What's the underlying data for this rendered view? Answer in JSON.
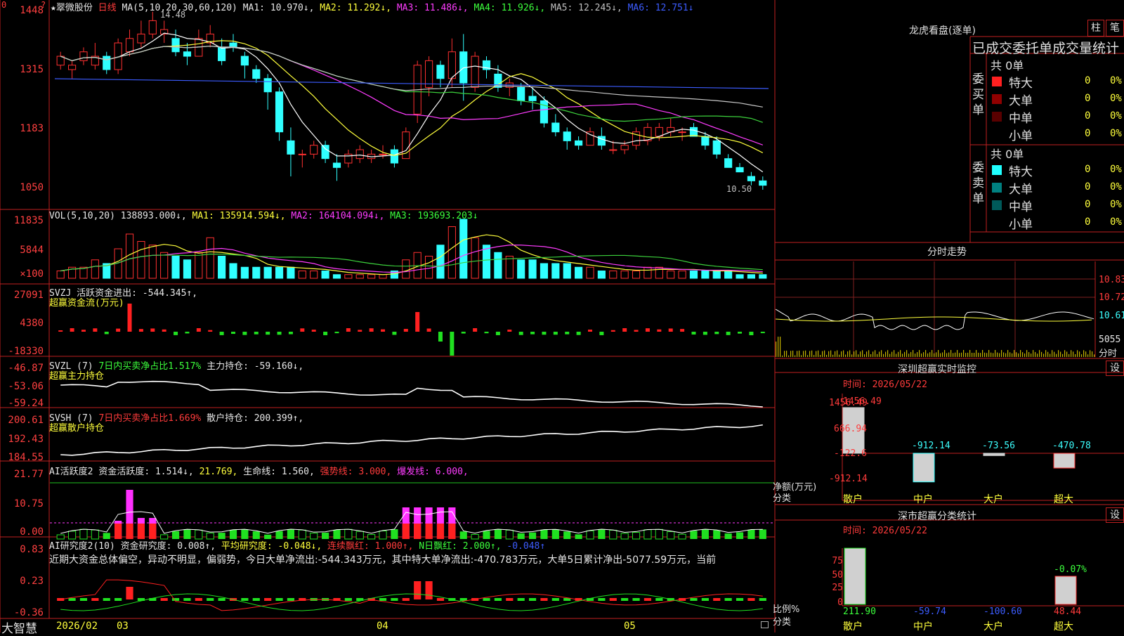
{
  "kline": {
    "title": "★翠微股份",
    "period": "日线",
    "ma_label": "MA(5,10,20,30,60,120)",
    "ma1": "MA1: 10.970↓,",
    "ma2": "MA2: 11.292↓,",
    "ma3": "MA3: 11.486↓,",
    "ma4": "MA4: 11.926↓,",
    "ma5": "MA5: 12.245↓,",
    "ma6": "MA6: 12.751↓",
    "high_mark": "14.48",
    "low_mark": "10.50",
    "y_ticks": [
      "1448",
      "1315",
      "1183",
      "1050"
    ],
    "candles": [
      [
        13.3,
        13.6,
        13.2,
        13.5
      ],
      [
        13.2,
        13.4,
        13.0,
        13.3
      ],
      [
        13.4,
        13.7,
        13.3,
        13.6
      ],
      [
        13.3,
        13.8,
        13.2,
        13.5
      ],
      [
        13.5,
        13.6,
        13.1,
        13.2
      ],
      [
        13.2,
        13.9,
        13.1,
        13.8
      ],
      [
        13.6,
        14.1,
        13.5,
        13.9
      ],
      [
        13.8,
        14.3,
        13.7,
        14.0
      ],
      [
        14.0,
        14.5,
        13.9,
        14.3
      ],
      [
        14.0,
        14.3,
        13.8,
        14.1
      ],
      [
        13.9,
        14.1,
        13.5,
        13.6
      ],
      [
        13.6,
        13.8,
        13.3,
        13.5
      ],
      [
        13.5,
        14.1,
        13.5,
        13.9
      ],
      [
        13.8,
        14.2,
        13.7,
        14.0
      ],
      [
        13.7,
        13.9,
        13.3,
        13.4
      ],
      [
        13.8,
        14.0,
        13.6,
        13.7
      ],
      [
        13.5,
        13.6,
        13.0,
        13.3
      ],
      [
        13.2,
        13.3,
        12.9,
        13.0
      ],
      [
        13.0,
        13.1,
        12.3,
        12.7
      ],
      [
        12.7,
        12.8,
        11.6,
        11.8
      ],
      [
        11.6,
        11.9,
        10.8,
        11.3
      ],
      [
        11.3,
        11.4,
        11.0,
        11.3
      ],
      [
        11.3,
        11.6,
        11.2,
        11.5
      ],
      [
        11.5,
        11.6,
        11.1,
        11.2
      ],
      [
        11.1,
        11.3,
        10.7,
        11.0
      ],
      [
        11.1,
        11.4,
        11.0,
        11.3
      ],
      [
        11.2,
        11.5,
        11.1,
        11.4
      ],
      [
        11.2,
        11.4,
        11.1,
        11.3
      ],
      [
        11.3,
        11.5,
        11.2,
        11.3
      ],
      [
        11.4,
        11.5,
        11.0,
        11.1
      ],
      [
        11.2,
        11.9,
        11.2,
        11.8
      ],
      [
        12.2,
        13.4,
        12.0,
        13.3
      ],
      [
        12.8,
        13.5,
        12.6,
        13.4
      ],
      [
        13.3,
        13.4,
        12.8,
        13.0
      ],
      [
        13.0,
        13.9,
        12.8,
        13.6
      ],
      [
        13.6,
        14.0,
        12.5,
        12.9
      ],
      [
        12.8,
        13.6,
        12.7,
        13.5
      ],
      [
        13.4,
        13.5,
        13.0,
        13.2
      ],
      [
        13.1,
        13.3,
        12.7,
        12.8
      ],
      [
        12.8,
        13.0,
        12.6,
        12.9
      ],
      [
        12.8,
        12.9,
        12.4,
        12.5
      ],
      [
        12.6,
        12.8,
        12.3,
        12.5
      ],
      [
        12.5,
        12.6,
        11.9,
        12.0
      ],
      [
        12.0,
        12.2,
        11.7,
        11.8
      ],
      [
        11.8,
        11.9,
        11.4,
        11.6
      ],
      [
        11.6,
        11.7,
        11.4,
        11.5
      ],
      [
        11.5,
        11.9,
        11.5,
        11.8
      ],
      [
        11.7,
        11.9,
        11.4,
        11.5
      ],
      [
        11.4,
        11.6,
        11.3,
        11.4
      ],
      [
        11.4,
        11.6,
        11.3,
        11.5
      ],
      [
        11.5,
        11.9,
        11.4,
        11.8
      ],
      [
        11.6,
        12.0,
        11.5,
        11.9
      ],
      [
        11.7,
        12.0,
        11.6,
        11.9
      ],
      [
        11.8,
        12.1,
        11.7,
        11.9
      ],
      [
        11.8,
        11.9,
        11.6,
        11.8
      ],
      [
        11.9,
        12.0,
        11.7,
        11.7
      ],
      [
        11.7,
        11.8,
        11.4,
        11.5
      ],
      [
        11.6,
        11.7,
        11.2,
        11.3
      ],
      [
        11.2,
        11.3,
        11.0,
        11.0
      ],
      [
        11.0,
        11.1,
        10.9,
        10.9
      ],
      [
        10.8,
        10.9,
        10.6,
        10.7
      ],
      [
        10.7,
        10.8,
        10.5,
        10.6
      ]
    ]
  },
  "vol": {
    "label": "VOL(5,10,20)",
    "val": "138893.000↓,",
    "ma1": "MA1: 135914.594↓,",
    "ma2": "MA2: 164104.094↓,",
    "ma3": "MA3: 193693.203↓",
    "y_ticks": [
      "11835",
      "5844",
      "×100"
    ],
    "bars": [
      2,
      3,
      3,
      5,
      4,
      8,
      12,
      10,
      9,
      7,
      6,
      5,
      7,
      11,
      6,
      4,
      3,
      3,
      3,
      3,
      3,
      2,
      2,
      2,
      1,
      1,
      1,
      1,
      1,
      2,
      5,
      7,
      6,
      9,
      14,
      16,
      11,
      9,
      7,
      6,
      5,
      5,
      4,
      4,
      4,
      3,
      3,
      2,
      2,
      2,
      2,
      3,
      3,
      2,
      2,
      2,
      2,
      2,
      2,
      1,
      1,
      1
    ]
  },
  "svzj": {
    "label": "SVZJ",
    "title": "活跃资金进出: -544.345↑,",
    "subtitle": "超赢资金流(万元)",
    "y_ticks": [
      "27091",
      "4380",
      "-18330"
    ]
  },
  "svzl": {
    "label": "SVZL (7)",
    "pct": "7日内买卖净占比1.517%",
    "hold": "主力持仓: -59.160↓,",
    "subtitle": "超赢主力持仓",
    "y_ticks": [
      "-46.87",
      "-53.06",
      "-59.24"
    ]
  },
  "svsh": {
    "label": "SVSH (7)",
    "pct": "7日内买卖净占比1.669%",
    "hold": "散户持仓: 200.399↑,",
    "subtitle": "超赢散户持仓",
    "y_ticks": [
      "200.61",
      "192.43",
      "184.55"
    ]
  },
  "ai_active": {
    "label": "AI活跃度2",
    "active": "资金活跃度: 1.514↓,",
    "v2": "21.769,",
    "life": "生命线: 1.560,",
    "strong": "强势线: 3.000,",
    "burst": "爆发线: 6.000,",
    "y_ticks": [
      "21.77",
      "10.75",
      "0.00"
    ]
  },
  "ai_research": {
    "label": "AI研究度2(10)",
    "research": "资金研究度: 0.008↑,",
    "avg": "平均研究度: -0.048↓,",
    "cont": "连续飘红: 1.000↑,",
    "nday": "N日飘红: 2.000↑,",
    "last": "-0.048↑",
    "summary": "近期大资金总体偏空，异动不明显，偏弱势，今日大单净流出:-544.343万元，其中特大单净流出:-470.783万元，大单5日累计净出-5077.59万元，当前",
    "y_ticks": [
      "0.83",
      "0.23",
      "-0.36"
    ]
  },
  "xaxis": {
    "logo": "大智慧",
    "labels": [
      "2026/02",
      "03",
      "04",
      "05"
    ]
  },
  "right": {
    "lhb_title": "龙虎看盘(逐单)",
    "btn_zhu": "柱",
    "btn_bi": "笔",
    "stats_title": "已成交委托单成交量统计",
    "buy": {
      "label": "委买单",
      "count": "共 0单",
      "rows": [
        {
          "name": "特大",
          "val": "0",
          "pct": "0%",
          "color": "#ff2020"
        },
        {
          "name": "大单",
          "val": "0",
          "pct": "0%",
          "color": "#900000"
        },
        {
          "name": "中单",
          "val": "0",
          "pct": "0%",
          "color": "#5a0000"
        },
        {
          "name": "小单",
          "val": "0",
          "pct": "0%",
          "color": "#000000"
        }
      ]
    },
    "sell": {
      "label": "委卖单",
      "count": "共 0单",
      "rows": [
        {
          "name": "特大",
          "val": "0",
          "pct": "0%",
          "color": "#20ffff"
        },
        {
          "name": "大单",
          "val": "0",
          "pct": "0%",
          "color": "#008080"
        },
        {
          "name": "中单",
          "val": "0",
          "pct": "0%",
          "color": "#005a5a"
        },
        {
          "name": "小单",
          "val": "0",
          "pct": "0%",
          "color": "#000000"
        }
      ]
    },
    "intraday": {
      "title": "分时走势",
      "y_ticks": [
        "10.83",
        "10.72",
        "10.61",
        "5055"
      ],
      "sub": "分时"
    },
    "monitor": {
      "title": "深圳超赢实时监控",
      "btn": "设",
      "time": "时间: 2026/05/22",
      "y_ticks": [
        "1456.49",
        "666.94",
        "-122.6",
        "-912.14"
      ],
      "ylabel1": "净额(万元)",
      "ylabel2": "分类",
      "cats": [
        "散户",
        "中户",
        "大户",
        "超大"
      ],
      "values": [
        1456.49,
        -912.14,
        -73.56,
        -470.78
      ],
      "labels": [
        "1456.49",
        "-912.14",
        "-73.56",
        "-470.78"
      ]
    },
    "classify": {
      "title": "深市超赢分类统计",
      "btn": "设",
      "time": "时间: 2026/05/22",
      "y_ticks": [
        "75",
        "50",
        "25",
        "0"
      ],
      "ylabel1": "比例%",
      "ylabel2": "分类",
      "top_label": "-0.07%",
      "cats": [
        "散户",
        "中户",
        "大户",
        "超大"
      ],
      "values": [
        "211.90",
        "-59.74",
        "-100.60",
        "48.44"
      ]
    }
  },
  "corner": {
    "top_left": "0",
    "top_mark": "?"
  },
  "colors": {
    "up": "#ff3030",
    "down": "#30ffff",
    "axis": "#c02020"
  }
}
